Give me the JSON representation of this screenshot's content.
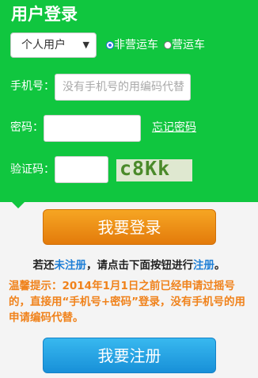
{
  "panel": {
    "title": "用户登录",
    "account_type": {
      "selected": "个人用户"
    },
    "radios": [
      {
        "label": "非营运车",
        "checked": true
      },
      {
        "label": "营运车",
        "checked": false
      }
    ],
    "phone": {
      "label": "手机号：",
      "placeholder": "没有手机号的用编码代替"
    },
    "password": {
      "label": "密码：",
      "value": "",
      "forgot_link": "忘记密码"
    },
    "captcha": {
      "label": "验证码：",
      "value": "",
      "image_text": "c8Kk"
    }
  },
  "login_button": "我要登录",
  "hint": {
    "prefix": "若还",
    "link1": "未注册",
    "middle": "，请点击下面按钮进行",
    "link2": "注册",
    "suffix": "。"
  },
  "warm_tip": "温馨提示：2014年1月1日之前已经申请过摇号的，直接用“手机号+密码”登录，没有手机号的用申请编码代替。",
  "register_button": "我要注册",
  "colors": {
    "panel_green": "#10c63f",
    "login_orange": "#e37b0b",
    "register_blue": "#1890d8",
    "tip_orange": "#f0821b",
    "link_blue": "#1f7fd6"
  }
}
